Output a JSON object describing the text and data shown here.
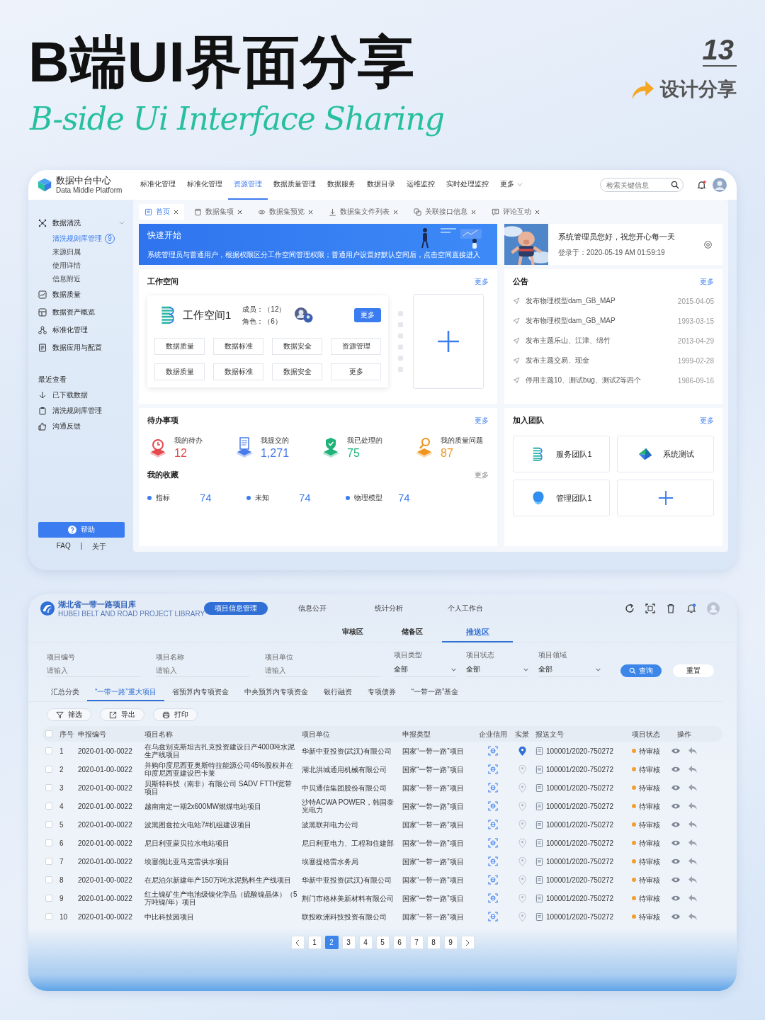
{
  "poster": {
    "title": "B端UI界面分享",
    "subtitle": "B-side Ui Interface Sharing",
    "number": "13",
    "tag": "设计分享"
  },
  "screen1": {
    "brand": {
      "name": "数据中台中心",
      "sub": "Data Middle Platform"
    },
    "nav": [
      {
        "label": "标准化管理",
        "selected": false
      },
      {
        "label": "标准化管理",
        "selected": false
      },
      {
        "label": "资源管理",
        "selected": true
      },
      {
        "label": "数据质量管理",
        "selected": false
      },
      {
        "label": "数据服务",
        "selected": false
      },
      {
        "label": "数据目录",
        "selected": false
      },
      {
        "label": "运维监控",
        "selected": false
      },
      {
        "label": "实时处理监控",
        "selected": false
      },
      {
        "label": "更多",
        "selected": false,
        "kind": "menu"
      }
    ],
    "search": {
      "placeholder": "检索关键信息"
    },
    "sidebar": {
      "groups": [
        {
          "label": "数据清洗",
          "expanded": true,
          "children": [
            {
              "label": "清洗规则库管理",
              "badge": "9",
              "selected": true
            },
            {
              "label": "来源归属",
              "selected": false
            },
            {
              "label": "使用详情",
              "selected": false
            },
            {
              "label": "信息附近",
              "selected": false
            }
          ]
        },
        {
          "label": "数据质量"
        },
        {
          "label": "数据资产概览"
        },
        {
          "label": "标准化管理"
        },
        {
          "label": "数据应用与配置"
        }
      ],
      "recent_title": "最近查看",
      "recent": [
        "已下载数据",
        "清洗规则库管理",
        "沟通反馈"
      ],
      "help": "帮助",
      "links": [
        "FAQ",
        "关于"
      ],
      "separator": "|"
    },
    "tabs": [
      {
        "label": "首页",
        "selected": true
      },
      {
        "label": "数据集项",
        "selected": false
      },
      {
        "label": "数据集预览",
        "selected": false
      },
      {
        "label": "数据集文件列表",
        "selected": false
      },
      {
        "label": "关联接口信息",
        "selected": false
      },
      {
        "label": "评论互动",
        "selected": false
      }
    ],
    "banner": {
      "title": "快速开始",
      "text": "系统管理员与普通用户，根据权限区分工作空间管理权限；普通用户设置好默认空间后，点击空间直接进入"
    },
    "welcome": {
      "greeting": "系统管理员您好，祝您开心每一天",
      "login": "登录于：2020-05-19  AM 01:59:19"
    },
    "workspace": {
      "title": "工作空间",
      "more": "更多",
      "name": "工作空间1",
      "members": "成员：（12）",
      "roles": "角色：（6）",
      "button": "更多",
      "actions": [
        "数据质量",
        "数据标准",
        "数据安全",
        "资源管理",
        "数据质量",
        "数据标准",
        "数据安全",
        "更多"
      ]
    },
    "notices": {
      "title": "公告",
      "more": "更多",
      "items": [
        {
          "text": "发布物理模型dam_GB_MAP",
          "date": "2015-04-05"
        },
        {
          "text": "发布物理模型dam_GB_MAP",
          "date": "1993-03-15"
        },
        {
          "text": "发布主题乐山、江津、绵竹",
          "date": "2013-04-29"
        },
        {
          "text": "发布主题交易、现金",
          "date": "1999-02-28"
        },
        {
          "text": "停用主题10、测试bug、测试2等四个",
          "date": "1986-09-16"
        }
      ]
    },
    "todo": {
      "title": "待办事项",
      "more": "更多",
      "items": [
        {
          "label": "我的待办",
          "value": "12",
          "color": "#e5484d"
        },
        {
          "label": "我提交的",
          "value": "1,271",
          "color": "#4a7bea"
        },
        {
          "label": "我已处理的",
          "value": "75",
          "color": "#1fb37a"
        },
        {
          "label": "我的质量问题",
          "value": "87",
          "color": "#f0961e"
        }
      ]
    },
    "favorites": {
      "title": "我的收藏",
      "more": "更多",
      "items": [
        {
          "label": "指标",
          "value": "74"
        },
        {
          "label": "未知",
          "value": "74"
        },
        {
          "label": "物理模型",
          "value": "74"
        }
      ]
    },
    "teams": {
      "title": "加入团队",
      "more": "更多",
      "items": [
        {
          "kind": "stripes",
          "name": "服务团队1"
        },
        {
          "kind": "prism",
          "name": "系统测试"
        },
        {
          "kind": "drop",
          "name": "管理团队1"
        },
        {
          "kind": "add"
        }
      ]
    }
  },
  "screen2": {
    "brand": {
      "name": "湖北省一带一路项目库",
      "sub": "HUBEI BELT AND ROAD PROJECT LIBRARY"
    },
    "nav": [
      {
        "label": "项目信息管理",
        "selected": true
      },
      {
        "label": "信息公开",
        "selected": false
      },
      {
        "label": "统计分析",
        "selected": false
      },
      {
        "label": "个人工作台",
        "selected": false
      }
    ],
    "zones": [
      {
        "label": "审核区",
        "selected": false
      },
      {
        "label": "储备区",
        "selected": false
      },
      {
        "label": "推送区",
        "selected": true
      }
    ],
    "filters": [
      {
        "kind": "input",
        "label": "项目编号",
        "placeholder": "请输入"
      },
      {
        "kind": "input",
        "label": "项目名称",
        "placeholder": "请输入"
      },
      {
        "kind": "input",
        "label": "项目单位",
        "placeholder": "请输入"
      },
      {
        "kind": "select",
        "label": "项目类型",
        "value": "全部"
      },
      {
        "kind": "select",
        "label": "项目状态",
        "value": "全部"
      },
      {
        "kind": "select",
        "label": "项目领域",
        "value": "全部"
      }
    ],
    "query": "查询",
    "reset": "重置",
    "categories": [
      {
        "label": "汇总分类",
        "selected": false
      },
      {
        "label": "“一带一路”重大项目",
        "selected": true
      },
      {
        "label": "省预算内专项资金",
        "selected": false
      },
      {
        "label": "中央预算内专项资金",
        "selected": false
      },
      {
        "label": "银行融资",
        "selected": false
      },
      {
        "label": "专项债券",
        "selected": false
      },
      {
        "label": "“一带一路”基金",
        "selected": false
      }
    ],
    "actions": [
      {
        "kind": "filter",
        "label": "筛选"
      },
      {
        "kind": "export",
        "label": "导出"
      },
      {
        "kind": "print",
        "label": "打印"
      }
    ],
    "all_checked": false,
    "columns": [
      "序号",
      "申报编号",
      "项目名称",
      "项目单位",
      "申报类型",
      "企业信用",
      "实景",
      "报送文号",
      "项目状态",
      "操作"
    ],
    "rows": [
      {
        "checked": false,
        "no": "1",
        "code": "2020-01-00-0022",
        "name": "在乌兹别克斯坦吉扎克投资建设日产4000吨水泥生产线项目",
        "unit": "华新中亚投资(武汉)有限公司",
        "type": "国家“一带一路”项目",
        "scene_active": true,
        "doc": "100001/2020-750272",
        "status": "待审核"
      },
      {
        "checked": false,
        "no": "2",
        "code": "2020-01-00-0022",
        "name": "并购印度尼西亚奥斯特拉能源公司45%股权并在印度尼西亚建设巴卡莱",
        "unit": "湖北洪城通用机械有限公司",
        "type": "国家“一带一路”项目",
        "scene_active": false,
        "doc": "100001/2020-750272",
        "status": "待审核"
      },
      {
        "checked": false,
        "no": "3",
        "code": "2020-01-00-0022",
        "name": "贝斯特科技（南非）有限公司 SADV FTTH宽带项目",
        "unit": "中贝通信集团股份有限公司",
        "type": "国家“一带一路”项目",
        "scene_active": false,
        "doc": "100001/2020-750272",
        "status": "待审核"
      },
      {
        "checked": false,
        "no": "4",
        "code": "2020-01-00-0022",
        "name": "越南南定一期2x600MW燃煤电站项目",
        "unit": "沙特ACWA POWER，韩国泰光电力",
        "type": "国家“一带一路”项目",
        "scene_active": false,
        "doc": "100001/2020-750272",
        "status": "待审核"
      },
      {
        "checked": false,
        "no": "5",
        "code": "2020-01-00-0022",
        "name": "波黑图兹拉火电站7#机组建设项目",
        "unit": "波黑联邦电力公司",
        "type": "国家“一带一路”项目",
        "scene_active": false,
        "doc": "100001/2020-750272",
        "status": "待审核"
      },
      {
        "checked": false,
        "no": "6",
        "code": "2020-01-00-0022",
        "name": "尼日利亚蒙贝拉水电站项目",
        "unit": "尼日利亚电力、工程和住建部",
        "type": "国家“一带一路”项目",
        "scene_active": false,
        "doc": "100001/2020-750272",
        "status": "待审核"
      },
      {
        "checked": false,
        "no": "7",
        "code": "2020-01-00-0022",
        "name": "埃塞俄比亚马克雷供水项目",
        "unit": "埃塞提格雷水务局",
        "type": "国家“一带一路”项目",
        "scene_active": false,
        "doc": "100001/2020-750272",
        "status": "待审核"
      },
      {
        "checked": false,
        "no": "8",
        "code": "2020-01-00-0022",
        "name": "在尼泊尔新建年产150万吨水泥熟料生产线项目",
        "unit": "华新中亚投资(武汉)有限公司",
        "type": "国家“一带一路”项目",
        "scene_active": false,
        "doc": "100001/2020-750272",
        "status": "待审核"
      },
      {
        "checked": false,
        "no": "9",
        "code": "2020-01-00-0022",
        "name": "红土镍矿生产电池级镍化学品（硫酸镍晶体）（5万吨镍/年）项目",
        "unit": "荆门市格林美新材料有限公司",
        "type": "国家“一带一路”项目",
        "scene_active": false,
        "doc": "100001/2020-750272",
        "status": "待审核"
      },
      {
        "checked": false,
        "no": "10",
        "code": "2020-01-00-0022",
        "name": "中比科技园项目",
        "unit": "联投欧洲科技投资有限公司",
        "type": "国家“一带一路”项目",
        "scene_active": false,
        "doc": "100001/2020-750272",
        "status": "待审核"
      }
    ],
    "pages": [
      {
        "label": "1",
        "selected": false
      },
      {
        "label": "2",
        "selected": true
      },
      {
        "label": "3",
        "selected": false
      },
      {
        "label": "4",
        "selected": false
      },
      {
        "label": "5",
        "selected": false
      },
      {
        "label": "6",
        "selected": false
      },
      {
        "label": "7",
        "selected": false
      },
      {
        "label": "8",
        "selected": false
      },
      {
        "label": "9",
        "selected": false
      }
    ]
  }
}
